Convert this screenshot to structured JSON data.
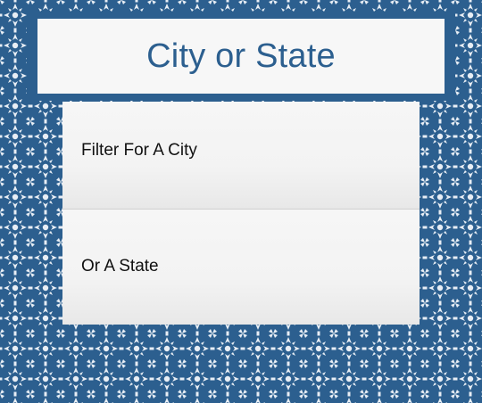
{
  "header": {
    "title": "City or State"
  },
  "menu": {
    "items": [
      {
        "label": "Filter For A City"
      },
      {
        "label": "Or A State"
      }
    ]
  },
  "colors": {
    "accent": "#2c5f8f",
    "panel": "#f7f7f7",
    "pattern": "#e8eef5"
  }
}
